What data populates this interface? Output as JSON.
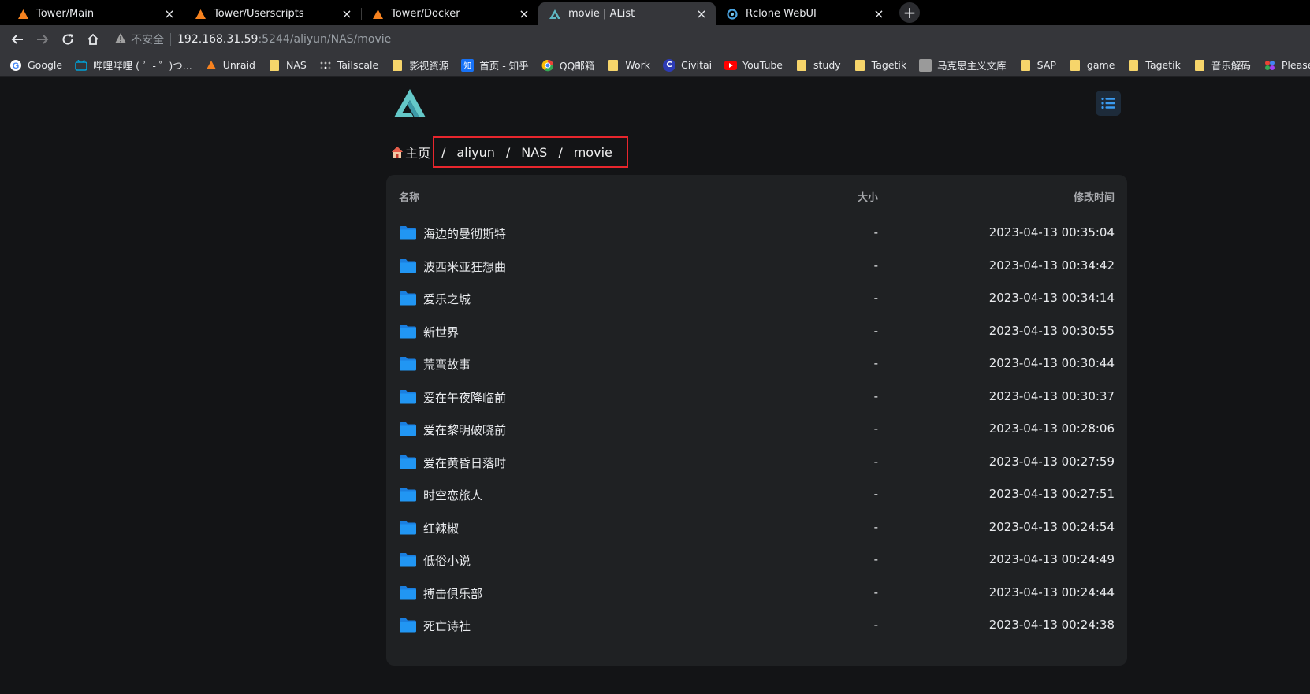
{
  "browser": {
    "tabs": [
      {
        "title": "Tower/Main",
        "icon": "unraid-icon",
        "active": false
      },
      {
        "title": "Tower/Userscripts",
        "icon": "unraid-icon",
        "active": false
      },
      {
        "title": "Tower/Docker",
        "icon": "unraid-icon",
        "active": false
      },
      {
        "title": "movie | AList",
        "icon": "alist-icon",
        "active": true
      },
      {
        "title": "Rclone WebUI",
        "icon": "rclone-icon",
        "active": false
      }
    ],
    "address": {
      "security_label": "不安全",
      "host": "192.168.31.59",
      "path": ":5244/aliyun/NAS/movie"
    },
    "bookmarks": [
      {
        "label": "Google",
        "icon": "google-icon"
      },
      {
        "label": "哔哩哔哩 ( ゜- ゜)つ...",
        "icon": "bilibili-icon"
      },
      {
        "label": "Unraid",
        "icon": "unraid-icon"
      },
      {
        "label": "NAS",
        "icon": "folder-icon"
      },
      {
        "label": "Tailscale",
        "icon": "tailscale-icon"
      },
      {
        "label": "影视资源",
        "icon": "folder-icon"
      },
      {
        "label": "首页 - 知乎",
        "icon": "zhihu-icon"
      },
      {
        "label": "QQ邮箱",
        "icon": "qqmail-icon"
      },
      {
        "label": "Work",
        "icon": "folder-icon"
      },
      {
        "label": "Civitai",
        "icon": "civitai-icon"
      },
      {
        "label": "YouTube",
        "icon": "youtube-icon"
      },
      {
        "label": "study",
        "icon": "folder-icon"
      },
      {
        "label": "Tagetik",
        "icon": "folder-icon"
      },
      {
        "label": "马克思主义文库",
        "icon": "marxists-icon"
      },
      {
        "label": "SAP",
        "icon": "folder-icon"
      },
      {
        "label": "game",
        "icon": "folder-icon"
      },
      {
        "label": "Tagetik",
        "icon": "folder-icon"
      },
      {
        "label": "音乐解码",
        "icon": "folder-icon"
      },
      {
        "label": "Please Wait...",
        "icon": "please-wait-icon"
      }
    ]
  },
  "breadcrumb": {
    "home": "主页",
    "parts": [
      "aliyun",
      "NAS",
      "movie"
    ]
  },
  "table": {
    "headers": {
      "name": "名称",
      "size": "大小",
      "modified": "修改时间"
    },
    "rows": [
      {
        "name": "海边的曼彻斯特",
        "size": "-",
        "modified": "2023-04-13 00:35:04"
      },
      {
        "name": "波西米亚狂想曲",
        "size": "-",
        "modified": "2023-04-13 00:34:42"
      },
      {
        "name": "爱乐之城",
        "size": "-",
        "modified": "2023-04-13 00:34:14"
      },
      {
        "name": "新世界",
        "size": "-",
        "modified": "2023-04-13 00:30:55"
      },
      {
        "name": "荒蛮故事",
        "size": "-",
        "modified": "2023-04-13 00:30:44"
      },
      {
        "name": "爱在午夜降临前",
        "size": "-",
        "modified": "2023-04-13 00:30:37"
      },
      {
        "name": "爱在黎明破晓前",
        "size": "-",
        "modified": "2023-04-13 00:28:06"
      },
      {
        "name": "爱在黄昏日落时",
        "size": "-",
        "modified": "2023-04-13 00:27:59"
      },
      {
        "name": "时空恋旅人",
        "size": "-",
        "modified": "2023-04-13 00:27:51"
      },
      {
        "name": "红辣椒",
        "size": "-",
        "modified": "2023-04-13 00:24:54"
      },
      {
        "name": "低俗小说",
        "size": "-",
        "modified": "2023-04-13 00:24:49"
      },
      {
        "name": "搏击俱乐部",
        "size": "-",
        "modified": "2023-04-13 00:24:44"
      },
      {
        "name": "死亡诗社",
        "size": "-",
        "modified": "2023-04-13 00:24:38"
      }
    ]
  },
  "colors": {
    "accent": "#1e88e5",
    "highlight": "#e8262d",
    "folder": "#2196f3"
  }
}
